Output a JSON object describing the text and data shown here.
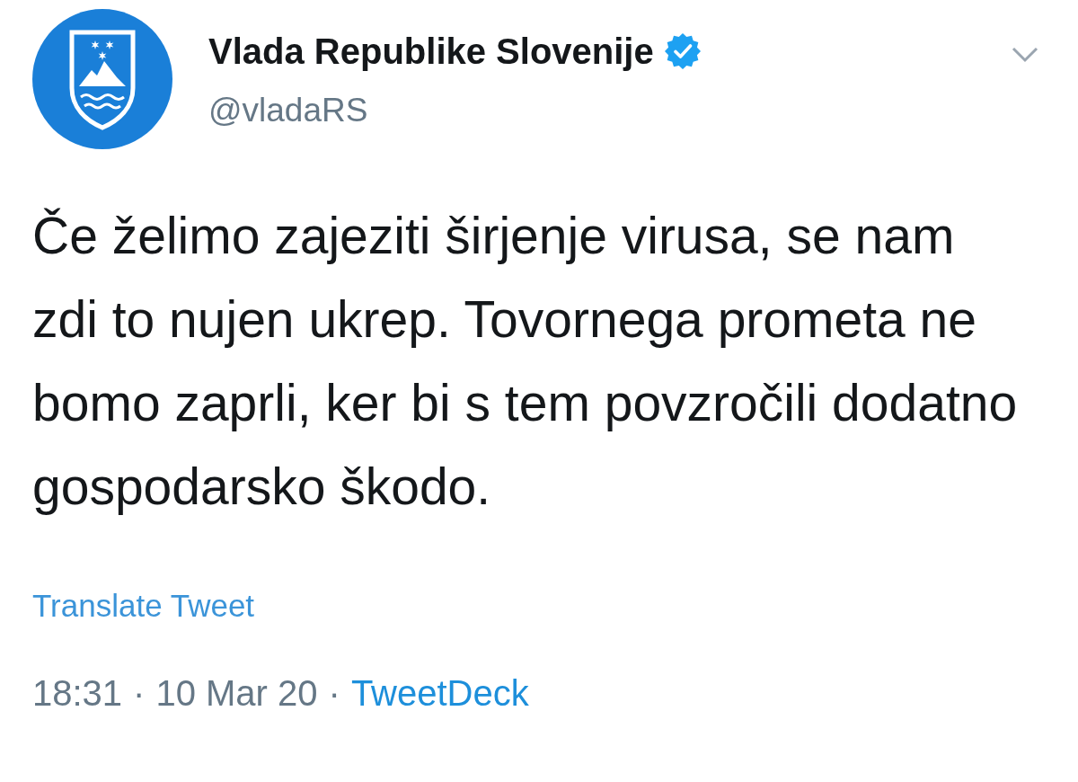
{
  "author": {
    "name": "Vlada Republike Slovenije",
    "verified": true,
    "handle": "@vladaRS"
  },
  "tweet": {
    "text": "Če želimo zajeziti širjenje virusa, se nam zdi to nujen ukrep. Tovornega prometa ne bomo zaprli, ker bi s tem povzročili dodatno gospodarsko škodo.",
    "translate_link": "Translate Tweet",
    "footer": [
      {
        "text": "18:31",
        "kind": "meta"
      },
      {
        "text": "·",
        "kind": "meta"
      },
      {
        "text": "10 Mar 20",
        "kind": "meta"
      },
      {
        "text": "·",
        "kind": "meta"
      },
      {
        "text": "TweetDeck",
        "kind": "link"
      }
    ]
  }
}
